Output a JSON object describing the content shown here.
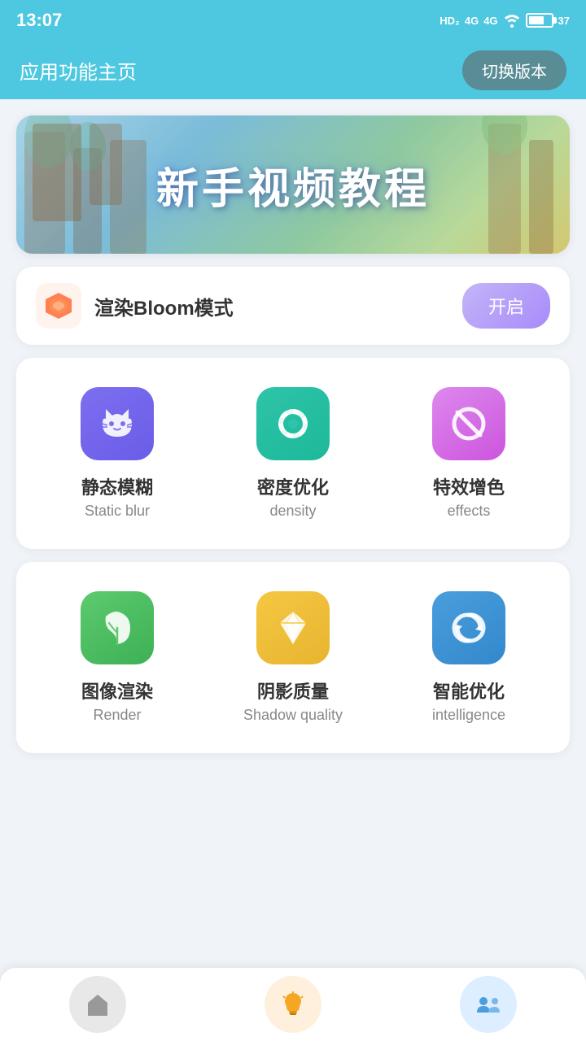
{
  "statusBar": {
    "time": "13:07",
    "batteryLevel": 37
  },
  "header": {
    "title": "应用功能主页",
    "versionBtn": "切换版本"
  },
  "banner": {
    "text": "新手视频教程"
  },
  "bloomMode": {
    "label": "渲染Bloom模式",
    "toggleLabel": "开启"
  },
  "grid1": [
    {
      "nameCn": "静态模糊",
      "nameEn": "Static blur",
      "iconColor": "icon-purple"
    },
    {
      "nameCn": "密度优化",
      "nameEn": "density",
      "iconColor": "icon-teal"
    },
    {
      "nameCn": "特效增色",
      "nameEn": "effects",
      "iconColor": "icon-pink"
    }
  ],
  "grid2": [
    {
      "nameCn": "图像渲染",
      "nameEn": "Render",
      "iconColor": "icon-green"
    },
    {
      "nameCn": "阴影质量",
      "nameEn": "Shadow quality",
      "iconColor": "icon-yellow"
    },
    {
      "nameCn": "智能优化",
      "nameEn": "intelligence",
      "iconColor": "icon-blue"
    }
  ],
  "bottomNav": [
    {
      "icon": "home-icon",
      "bg": "nav-home-bg"
    },
    {
      "icon": "tip-icon",
      "bg": "nav-tip-bg"
    },
    {
      "icon": "chat-icon",
      "bg": "nav-chat-bg"
    }
  ]
}
